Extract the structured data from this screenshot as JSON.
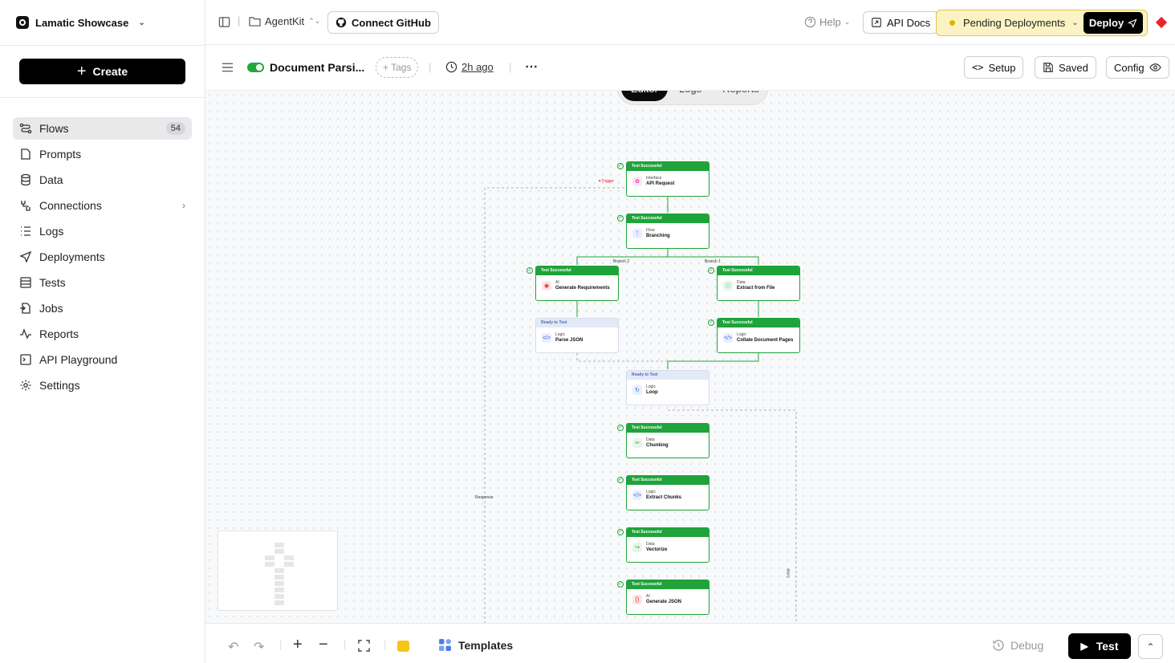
{
  "workspace": {
    "name": "Lamatic Showcase"
  },
  "sidebar": {
    "create_label": "Create",
    "items": [
      {
        "label": "Flows",
        "count": "54",
        "icon": "flows-icon"
      },
      {
        "label": "Prompts",
        "icon": "prompts-icon"
      },
      {
        "label": "Data",
        "icon": "database-icon"
      },
      {
        "label": "Connections",
        "icon": "connections-icon"
      },
      {
        "label": "Logs",
        "icon": "logs-icon"
      },
      {
        "label": "Deployments",
        "icon": "send-icon"
      },
      {
        "label": "Tests",
        "icon": "tests-icon"
      },
      {
        "label": "Jobs",
        "icon": "jobs-icon"
      },
      {
        "label": "Reports",
        "icon": "reports-icon"
      },
      {
        "label": "API Playground",
        "icon": "terminal-icon"
      },
      {
        "label": "Settings",
        "icon": "gear-icon"
      }
    ]
  },
  "topbar": {
    "project": "AgentKit",
    "github": "Connect GitHub",
    "help": "Help",
    "api_docs": "API Docs",
    "pending": "Pending Deployments",
    "deploy": "Deploy"
  },
  "subbar": {
    "flow_name": "Document Parsi...",
    "tags": "+ Tags",
    "time": "2h ago",
    "setup": "Setup",
    "saved": "Saved",
    "config": "Config"
  },
  "tabs": {
    "editor": "Editor",
    "logs": "Logs",
    "reports": "Reports"
  },
  "flow": {
    "nodes": [
      {
        "status": "Test Successful",
        "type": "Interface",
        "name": "API Request"
      },
      {
        "status": "Test Successful",
        "type": "Flow",
        "name": "Branching"
      },
      {
        "status": "Test Successful",
        "type": "AI",
        "name": "Generate Requirements"
      },
      {
        "status": "Test Successful",
        "type": "Data",
        "name": "Extract from File"
      },
      {
        "status": "Ready to Test",
        "type": "Logic",
        "name": "Parse JSON"
      },
      {
        "status": "Test Successful",
        "type": "Logic",
        "name": "Collate Document Pages"
      },
      {
        "status": "Ready to Test",
        "type": "Logic",
        "name": "Loop"
      },
      {
        "status": "Test Successful",
        "type": "Data",
        "name": "Chunking"
      },
      {
        "status": "Test Successful",
        "type": "Logic",
        "name": "Extract Chunks"
      },
      {
        "status": "Test Successful",
        "type": "Data",
        "name": "Vectorize"
      },
      {
        "status": "Test Successful",
        "type": "AI",
        "name": "Generate JSON"
      }
    ],
    "edge_labels": {
      "trigger": "✦Trigger",
      "branch2": "Branch 2",
      "branch1": "Branch 1",
      "response": "Response",
      "loop": "Loop"
    }
  },
  "bottom": {
    "templates": "Templates",
    "debug": "Debug",
    "test": "Test"
  }
}
